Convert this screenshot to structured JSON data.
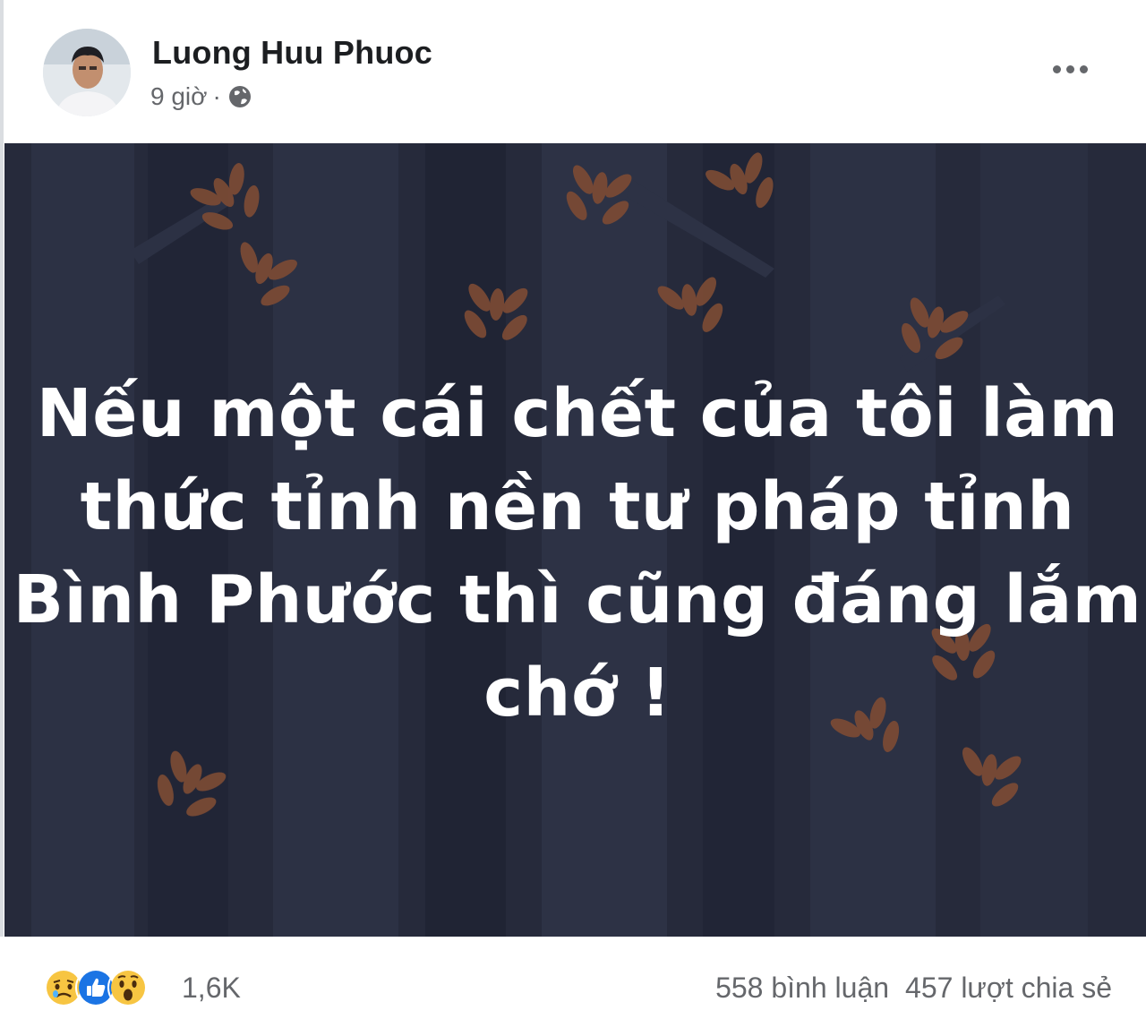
{
  "post": {
    "author": "Luong Huu Phuoc",
    "time": "9 giờ",
    "separator": "·",
    "privacy_icon": "globe-icon",
    "more_icon": "more-options-icon"
  },
  "media": {
    "caption_lines": [
      "Nếu một cái chết của tôi làm",
      "thức tỉnh nền tư pháp tỉnh",
      "Bình Phước thì cũng đáng lắm",
      "chớ !"
    ],
    "background_color": "#262a3b",
    "leaf_color": "#7a4a35"
  },
  "engagement": {
    "reactions": [
      "sad-reaction-icon",
      "like-reaction-icon",
      "wow-reaction-icon"
    ],
    "reaction_count": "1,6K",
    "comments": "558 bình luận",
    "shares": "457 lượt chia sẻ"
  }
}
